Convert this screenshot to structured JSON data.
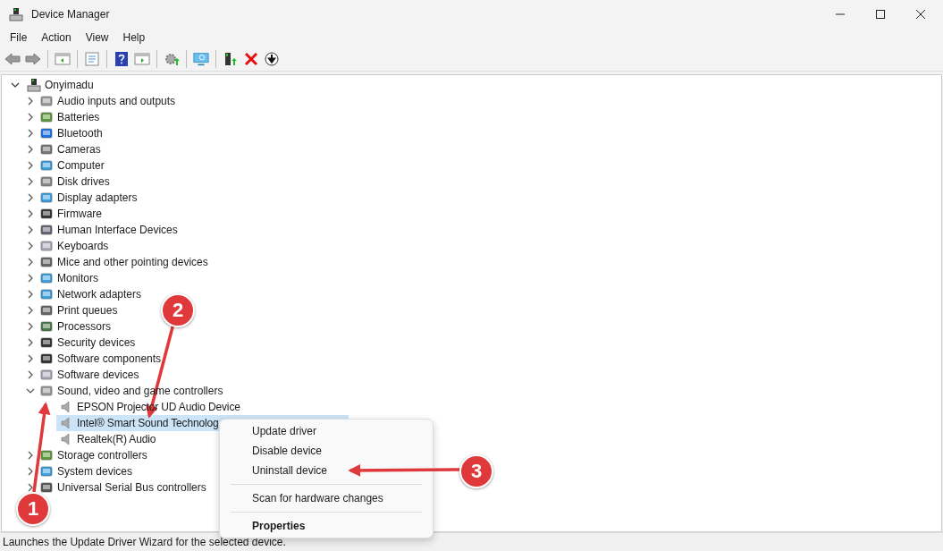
{
  "window": {
    "title": "Device Manager"
  },
  "menu": [
    "File",
    "Action",
    "View",
    "Help"
  ],
  "tree": {
    "label": "Onyimadu",
    "expanded": true,
    "children": [
      {
        "label": "Audio inputs and outputs",
        "expanded": false
      },
      {
        "label": "Batteries",
        "expanded": false
      },
      {
        "label": "Bluetooth",
        "expanded": false
      },
      {
        "label": "Cameras",
        "expanded": false
      },
      {
        "label": "Computer",
        "expanded": false
      },
      {
        "label": "Disk drives",
        "expanded": false
      },
      {
        "label": "Display adapters",
        "expanded": false
      },
      {
        "label": "Firmware",
        "expanded": false
      },
      {
        "label": "Human Interface Devices",
        "expanded": false
      },
      {
        "label": "Keyboards",
        "expanded": false
      },
      {
        "label": "Mice and other pointing devices",
        "expanded": false
      },
      {
        "label": "Monitors",
        "expanded": false
      },
      {
        "label": "Network adapters",
        "expanded": false
      },
      {
        "label": "Print queues",
        "expanded": false
      },
      {
        "label": "Processors",
        "expanded": false
      },
      {
        "label": "Security devices",
        "expanded": false
      },
      {
        "label": "Software components",
        "expanded": false
      },
      {
        "label": "Software devices",
        "expanded": false
      },
      {
        "label": "Sound, video and game controllers",
        "expanded": true,
        "children": [
          {
            "label": "EPSON Projector UD Audio Device",
            "selected": false
          },
          {
            "label": "Intel® Smart Sound Technolog",
            "selected": true
          },
          {
            "label": "Realtek(R) Audio",
            "selected": false
          }
        ]
      },
      {
        "label": "Storage controllers",
        "expanded": false
      },
      {
        "label": "System devices",
        "expanded": false
      },
      {
        "label": "Universal Serial Bus controllers",
        "expanded": false
      }
    ]
  },
  "context_menu": [
    {
      "label": "Update driver",
      "kind": "item"
    },
    {
      "label": "Disable device",
      "kind": "item"
    },
    {
      "label": "Uninstall device",
      "kind": "item"
    },
    {
      "kind": "separator"
    },
    {
      "label": "Scan for hardware changes",
      "kind": "item"
    },
    {
      "kind": "separator"
    },
    {
      "label": "Properties",
      "kind": "default"
    }
  ],
  "status_bar": "Launches the Update Driver Wizard for the selected device.",
  "annotations": [
    {
      "label": "1"
    },
    {
      "label": "2"
    },
    {
      "label": "3"
    }
  ]
}
